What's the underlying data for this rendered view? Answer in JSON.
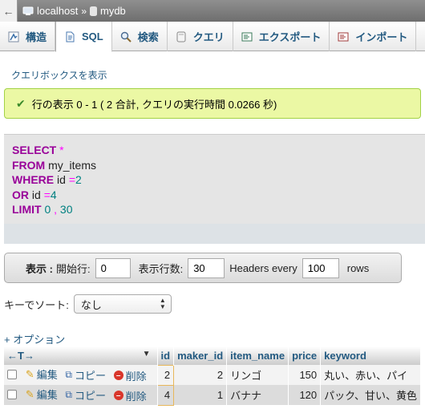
{
  "breadcrumb": {
    "back": "←",
    "server": "localhost",
    "separator": "»",
    "database": "mydb"
  },
  "tabs": [
    {
      "label": "構造",
      "icon": "structure-icon"
    },
    {
      "label": "SQL",
      "icon": "sql-icon",
      "active": true
    },
    {
      "label": "検索",
      "icon": "search-icon"
    },
    {
      "label": "クエリ",
      "icon": "query-icon"
    },
    {
      "label": "エクスポート",
      "icon": "export-icon"
    },
    {
      "label": "インポート",
      "icon": "import-icon"
    }
  ],
  "show_query_box": "クエリボックスを表示",
  "success_message": "行の表示 0 - 1 ( 2 合計, クエリの実行時間 0.0266 秒)",
  "sql": {
    "l1_kw": "SELECT",
    "l1_op": "*",
    "l2_kw": "FROM",
    "l2_tbl": "my_items",
    "l3_kw": "WHERE",
    "l3_col": "id",
    "l3_op": "=",
    "l3_val": "2",
    "l4_kw": "OR",
    "l4_col": "id",
    "l4_op": "=",
    "l4_val": "4",
    "l5_kw": "LIMIT",
    "l5_a": "0",
    "l5_sep": ",",
    "l5_b": "30"
  },
  "nav": {
    "show_label": "表示 :",
    "start_label": "開始行:",
    "start_value": "0",
    "rows_label": "表示行数:",
    "rows_value": "30",
    "headers_label": "Headers every",
    "headers_value": "100",
    "rows_suffix": "rows"
  },
  "sort": {
    "label": "キーでソート:",
    "value": "なし"
  },
  "options_link": "+ オプション",
  "table": {
    "arrows": "←T→",
    "columns": [
      "id",
      "maker_id",
      "item_name",
      "price",
      "keyword"
    ],
    "actions": {
      "edit": "編集",
      "copy": "コピー",
      "delete": "削除"
    },
    "rows": [
      {
        "id": "2",
        "maker_id": "2",
        "item_name": "リンゴ",
        "price": "150",
        "keyword": "丸い、赤い、パイ"
      },
      {
        "id": "4",
        "maker_id": "1",
        "item_name": "バナナ",
        "price": "120",
        "keyword": "パック、甘い、黄色"
      }
    ]
  }
}
